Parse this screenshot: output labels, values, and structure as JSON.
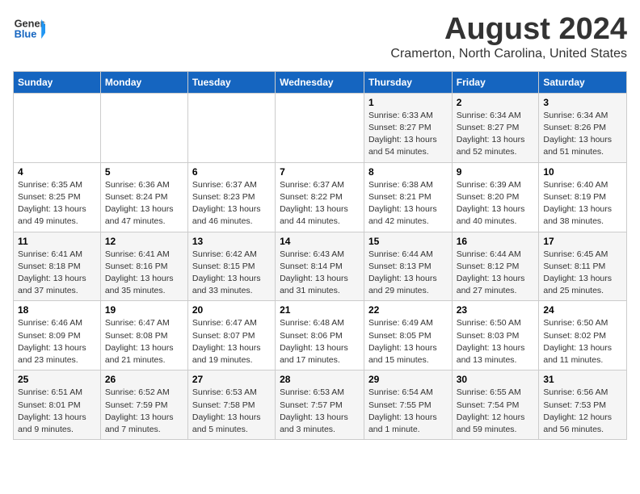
{
  "header": {
    "logo_line1": "General",
    "logo_line2": "Blue",
    "month_title": "August 2024",
    "subtitle": "Cramerton, North Carolina, United States"
  },
  "weekdays": [
    "Sunday",
    "Monday",
    "Tuesday",
    "Wednesday",
    "Thursday",
    "Friday",
    "Saturday"
  ],
  "weeks": [
    [
      {
        "day": "",
        "info": ""
      },
      {
        "day": "",
        "info": ""
      },
      {
        "day": "",
        "info": ""
      },
      {
        "day": "",
        "info": ""
      },
      {
        "day": "1",
        "info": "Sunrise: 6:33 AM\nSunset: 8:27 PM\nDaylight: 13 hours\nand 54 minutes."
      },
      {
        "day": "2",
        "info": "Sunrise: 6:34 AM\nSunset: 8:27 PM\nDaylight: 13 hours\nand 52 minutes."
      },
      {
        "day": "3",
        "info": "Sunrise: 6:34 AM\nSunset: 8:26 PM\nDaylight: 13 hours\nand 51 minutes."
      }
    ],
    [
      {
        "day": "4",
        "info": "Sunrise: 6:35 AM\nSunset: 8:25 PM\nDaylight: 13 hours\nand 49 minutes."
      },
      {
        "day": "5",
        "info": "Sunrise: 6:36 AM\nSunset: 8:24 PM\nDaylight: 13 hours\nand 47 minutes."
      },
      {
        "day": "6",
        "info": "Sunrise: 6:37 AM\nSunset: 8:23 PM\nDaylight: 13 hours\nand 46 minutes."
      },
      {
        "day": "7",
        "info": "Sunrise: 6:37 AM\nSunset: 8:22 PM\nDaylight: 13 hours\nand 44 minutes."
      },
      {
        "day": "8",
        "info": "Sunrise: 6:38 AM\nSunset: 8:21 PM\nDaylight: 13 hours\nand 42 minutes."
      },
      {
        "day": "9",
        "info": "Sunrise: 6:39 AM\nSunset: 8:20 PM\nDaylight: 13 hours\nand 40 minutes."
      },
      {
        "day": "10",
        "info": "Sunrise: 6:40 AM\nSunset: 8:19 PM\nDaylight: 13 hours\nand 38 minutes."
      }
    ],
    [
      {
        "day": "11",
        "info": "Sunrise: 6:41 AM\nSunset: 8:18 PM\nDaylight: 13 hours\nand 37 minutes."
      },
      {
        "day": "12",
        "info": "Sunrise: 6:41 AM\nSunset: 8:16 PM\nDaylight: 13 hours\nand 35 minutes."
      },
      {
        "day": "13",
        "info": "Sunrise: 6:42 AM\nSunset: 8:15 PM\nDaylight: 13 hours\nand 33 minutes."
      },
      {
        "day": "14",
        "info": "Sunrise: 6:43 AM\nSunset: 8:14 PM\nDaylight: 13 hours\nand 31 minutes."
      },
      {
        "day": "15",
        "info": "Sunrise: 6:44 AM\nSunset: 8:13 PM\nDaylight: 13 hours\nand 29 minutes."
      },
      {
        "day": "16",
        "info": "Sunrise: 6:44 AM\nSunset: 8:12 PM\nDaylight: 13 hours\nand 27 minutes."
      },
      {
        "day": "17",
        "info": "Sunrise: 6:45 AM\nSunset: 8:11 PM\nDaylight: 13 hours\nand 25 minutes."
      }
    ],
    [
      {
        "day": "18",
        "info": "Sunrise: 6:46 AM\nSunset: 8:09 PM\nDaylight: 13 hours\nand 23 minutes."
      },
      {
        "day": "19",
        "info": "Sunrise: 6:47 AM\nSunset: 8:08 PM\nDaylight: 13 hours\nand 21 minutes."
      },
      {
        "day": "20",
        "info": "Sunrise: 6:47 AM\nSunset: 8:07 PM\nDaylight: 13 hours\nand 19 minutes."
      },
      {
        "day": "21",
        "info": "Sunrise: 6:48 AM\nSunset: 8:06 PM\nDaylight: 13 hours\nand 17 minutes."
      },
      {
        "day": "22",
        "info": "Sunrise: 6:49 AM\nSunset: 8:05 PM\nDaylight: 13 hours\nand 15 minutes."
      },
      {
        "day": "23",
        "info": "Sunrise: 6:50 AM\nSunset: 8:03 PM\nDaylight: 13 hours\nand 13 minutes."
      },
      {
        "day": "24",
        "info": "Sunrise: 6:50 AM\nSunset: 8:02 PM\nDaylight: 13 hours\nand 11 minutes."
      }
    ],
    [
      {
        "day": "25",
        "info": "Sunrise: 6:51 AM\nSunset: 8:01 PM\nDaylight: 13 hours\nand 9 minutes."
      },
      {
        "day": "26",
        "info": "Sunrise: 6:52 AM\nSunset: 7:59 PM\nDaylight: 13 hours\nand 7 minutes."
      },
      {
        "day": "27",
        "info": "Sunrise: 6:53 AM\nSunset: 7:58 PM\nDaylight: 13 hours\nand 5 minutes."
      },
      {
        "day": "28",
        "info": "Sunrise: 6:53 AM\nSunset: 7:57 PM\nDaylight: 13 hours\nand 3 minutes."
      },
      {
        "day": "29",
        "info": "Sunrise: 6:54 AM\nSunset: 7:55 PM\nDaylight: 13 hours\nand 1 minute."
      },
      {
        "day": "30",
        "info": "Sunrise: 6:55 AM\nSunset: 7:54 PM\nDaylight: 12 hours\nand 59 minutes."
      },
      {
        "day": "31",
        "info": "Sunrise: 6:56 AM\nSunset: 7:53 PM\nDaylight: 12 hours\nand 56 minutes."
      }
    ]
  ]
}
